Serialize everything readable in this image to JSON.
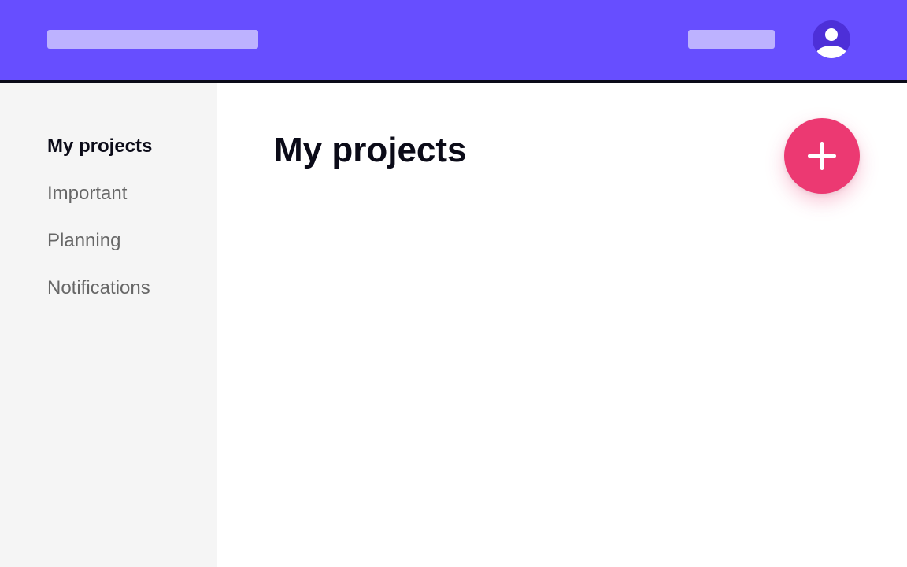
{
  "sidebar": {
    "items": [
      {
        "label": "My projects",
        "active": true
      },
      {
        "label": "Important",
        "active": false
      },
      {
        "label": "Planning",
        "active": false
      },
      {
        "label": "Notifications",
        "active": false
      }
    ]
  },
  "main": {
    "title": "My projects"
  },
  "icons": {
    "avatar": "user-avatar-icon",
    "add": "plus-icon"
  },
  "colors": {
    "header": "#674eff",
    "header_placeholder": "#bdb2ff",
    "avatar": "#4d2fd8",
    "sidebar": "#f5f5f5",
    "accent": "#ec3972",
    "text_primary": "#0b0b18",
    "text_secondary": "#676767"
  }
}
